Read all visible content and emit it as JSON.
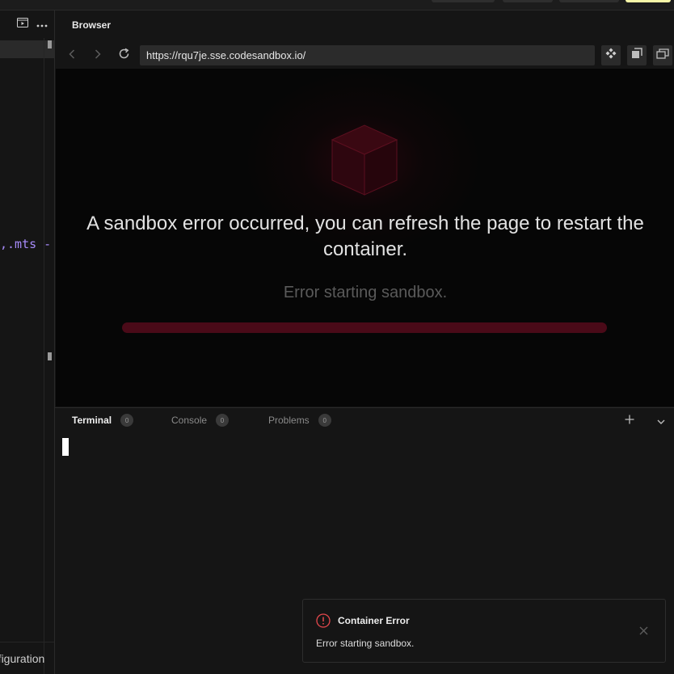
{
  "browser": {
    "title": "Browser",
    "url": "https://rqu7je.sse.codesandbox.io/"
  },
  "editor": {
    "code_fragment": ",.mts -",
    "footer_text": "Configuration"
  },
  "preview": {
    "error_heading": "A sandbox error occurred, you can refresh the page to restart the container.",
    "error_subtitle": "Error starting sandbox.",
    "progress_fraction": 1.0
  },
  "terminal": {
    "tabs": [
      {
        "label": "Terminal",
        "count": "0"
      },
      {
        "label": "Console",
        "count": "0"
      },
      {
        "label": "Problems",
        "count": "0"
      }
    ]
  },
  "toast": {
    "title": "Container Error",
    "message": "Error starting sandbox."
  },
  "colors": {
    "error_accent": "#e5484d",
    "progress": "#4a0a18",
    "highlight": "#f7f7a8"
  },
  "icons": {
    "panel_toggle": "panel-icon",
    "more": "more-icon",
    "back": "chevron-left-icon",
    "forward": "chevron-right-icon",
    "refresh": "refresh-icon",
    "devtools": "devtools-icon",
    "new_window": "new-window-icon",
    "windows": "windows-icon",
    "add": "plus-icon",
    "collapse": "chevron-down-icon",
    "alert": "alert-icon",
    "close": "close-icon"
  }
}
